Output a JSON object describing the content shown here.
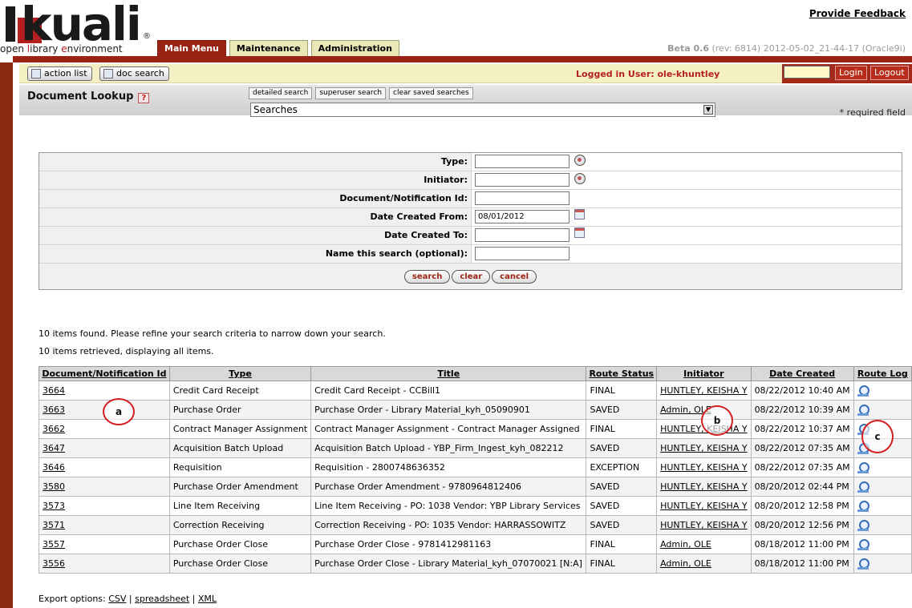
{
  "header": {
    "logo_text": "kuali",
    "logo_reg": "®",
    "tagline_parts": [
      "open ",
      "l",
      "ibrary ",
      "e",
      "nvironment"
    ],
    "feedback_link": "Provide Feedback",
    "version_label": "Beta 0.6",
    "version_detail": " (rev: 6814) 2012-05-02_21-44-17 (Oracle9i)",
    "tabs": [
      {
        "label": "Main Menu",
        "active": true
      },
      {
        "label": "Maintenance",
        "active": false
      },
      {
        "label": "Administration",
        "active": false
      }
    ]
  },
  "actionbar": {
    "action_list": "action list",
    "doc_search": "doc search",
    "logged_in": "Logged in User: ole-khuntley",
    "login_button": "Login",
    "logout_button": "Logout"
  },
  "lookup": {
    "title": "Document Lookup",
    "help": "?",
    "links": [
      "detailed search",
      "superuser search",
      "clear saved searches"
    ],
    "searches_select": "Searches",
    "required_note": "* required field"
  },
  "criteria": {
    "fields": [
      {
        "label": "Type:",
        "value": "",
        "icon": "lookup-icon"
      },
      {
        "label": "Initiator:",
        "value": "",
        "icon": "lookup-icon"
      },
      {
        "label": "Document/Notification Id:",
        "value": "",
        "icon": ""
      },
      {
        "label": "Date Created From:",
        "value": "08/01/2012",
        "icon": "calendar-icon"
      },
      {
        "label": "Date Created To:",
        "value": "",
        "icon": "calendar-icon"
      },
      {
        "label": "Name this search (optional):",
        "value": "",
        "icon": ""
      }
    ],
    "buttons": [
      "search",
      "clear",
      "cancel"
    ]
  },
  "results": {
    "found_text": "10 items found. Please refine your search criteria to narrow down your search.",
    "retrieved_text": "10 items retrieved, displaying all items.",
    "columns": [
      "Document/Notification Id",
      "Type",
      "Title",
      "Route Status",
      "Initiator",
      "Date Created",
      "Route Log"
    ],
    "rows": [
      {
        "id": "3664",
        "type": "Credit Card Receipt",
        "title": "Credit Card Receipt - CCBill1",
        "status": "FINAL",
        "initiator": "HUNTLEY, KEISHA Y",
        "date": "08/22/2012 10:40 AM"
      },
      {
        "id": "3663",
        "type": "Purchase Order",
        "title": "Purchase Order - Library Material_kyh_05090901",
        "status": "SAVED",
        "initiator": "Admin, OLE",
        "date": "08/22/2012 10:39 AM"
      },
      {
        "id": "3662",
        "type": "Contract Manager Assignment",
        "title": "Contract Manager Assignment - Contract Manager Assigned",
        "status": "FINAL",
        "initiator": "HUNTLEY, KEISHA Y",
        "date": "08/22/2012 10:37 AM"
      },
      {
        "id": "3647",
        "type": "Acquisition Batch Upload",
        "title": "Acquisition Batch Upload - YBP_Firm_Ingest_kyh_082212",
        "status": "SAVED",
        "initiator": "HUNTLEY, KEISHA Y",
        "date": "08/22/2012 07:35 AM"
      },
      {
        "id": "3646",
        "type": "Requisition",
        "title": "Requisition - 2800748636352",
        "status": "EXCEPTION",
        "initiator": "HUNTLEY, KEISHA Y",
        "date": "08/22/2012 07:35 AM"
      },
      {
        "id": "3580",
        "type": "Purchase Order Amendment",
        "title": "Purchase Order Amendment - 9780964812406",
        "status": "SAVED",
        "initiator": "HUNTLEY, KEISHA Y",
        "date": "08/20/2012 02:44 PM"
      },
      {
        "id": "3573",
        "type": "Line Item Receiving",
        "title": "Line Item Receiving - PO: 1038 Vendor: YBP Library Services",
        "status": "SAVED",
        "initiator": "HUNTLEY, KEISHA Y",
        "date": "08/20/2012 12:58 PM"
      },
      {
        "id": "3571",
        "type": "Correction Receiving",
        "title": "Correction Receiving - PO: 1035 Vendor: HARRASSOWITZ",
        "status": "SAVED",
        "initiator": "HUNTLEY, KEISHA Y",
        "date": "08/20/2012 12:56 PM"
      },
      {
        "id": "3557",
        "type": "Purchase Order Close",
        "title": "Purchase Order Close - 9781412981163",
        "status": "FINAL",
        "initiator": "Admin, OLE",
        "date": "08/18/2012 11:00 PM"
      },
      {
        "id": "3556",
        "type": "Purchase Order Close",
        "title": "Purchase Order Close - Library Material_kyh_07070021 [N:A]",
        "status": "FINAL",
        "initiator": "Admin, OLE",
        "date": "08/18/2012 11:00 PM"
      }
    ]
  },
  "export": {
    "label": "Export options: ",
    "options": [
      "CSV",
      "spreadsheet",
      "XML"
    ],
    "separator": " | "
  },
  "annotations": [
    "a",
    "b",
    "c"
  ],
  "colors": {
    "brand_red": "#9a2414",
    "tab_yellow": "#e9e6b8",
    "logged_red": "#b51f1f"
  }
}
